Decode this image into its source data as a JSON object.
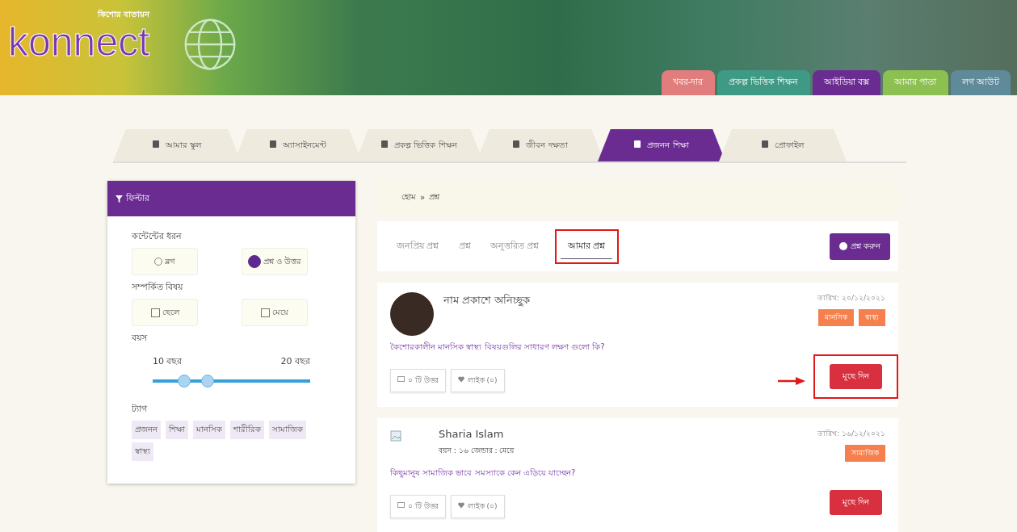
{
  "logo": {
    "tagline": "কিশোর বাতায়ন",
    "name": "konnect"
  },
  "top_nav": [
    {
      "label": "খবর-দার",
      "color": "#e27d7d"
    },
    {
      "label": "প্রকল্প ভিত্তিক শিক্ষন",
      "color": "#3f9a85"
    },
    {
      "label": "আইডিয়া বক্স",
      "color": "#6a2c91"
    },
    {
      "label": "আমার পাতা",
      "color": "#8cc152"
    },
    {
      "label": "লগ আউট",
      "color": "#5f8a99"
    }
  ],
  "tabs": [
    {
      "label": "আমার স্কুল",
      "selected": false
    },
    {
      "label": "অ্যাসাইনমেন্ট",
      "selected": false
    },
    {
      "label": "প্রকল্প ভিত্তিক শিক্ষন",
      "selected": false
    },
    {
      "label": "জীবন দক্ষতা",
      "selected": false
    },
    {
      "label": "প্রজনন শিক্ষা",
      "selected": true
    },
    {
      "label": "প্রোফাইল",
      "selected": false
    }
  ],
  "filter": {
    "title": "ফিল্টার",
    "content_type": {
      "label": "কন্টেন্টের ধরন",
      "options": [
        {
          "label": "ব্লগ",
          "selected": false
        },
        {
          "label": "প্রশ্ন ও উত্তর",
          "selected": true
        }
      ]
    },
    "related": {
      "label": "সম্পর্কিত বিষয়",
      "options": [
        {
          "label": "ছেলে",
          "checked": false
        },
        {
          "label": "মেয়ে",
          "checked": false
        }
      ]
    },
    "age": {
      "label": "বয়স",
      "low_label": "10 বছর",
      "high_label": "20 বছর",
      "thumbs": [
        {
          "level": 0.2
        },
        {
          "level": 0.35
        }
      ]
    },
    "tags": {
      "label": "ট্যাগ",
      "items": [
        "প্রজনন",
        "শিক্ষা",
        "মানসিক",
        "শারীরিক",
        "সামাজিক",
        "স্বাস্থ্য"
      ]
    }
  },
  "breadcrumb": [
    "হোম",
    "»",
    "প্রশ্ন"
  ],
  "question_tabs": [
    {
      "label": "জনপ্রিয় প্রশ্ন",
      "selected": false,
      "outlined": false
    },
    {
      "label": "প্রশ্ন",
      "selected": false,
      "outlined": false
    },
    {
      "label": "অনুত্তরিত প্রশ্ন",
      "selected": false,
      "outlined": false
    },
    {
      "label": "আমার প্রশ্ন",
      "selected": true,
      "outlined": true
    }
  ],
  "ask_button": "প্রশ্ন করুন",
  "questions": [
    {
      "kind": "photo",
      "name": "নাম প্রকাশে অনিচ্ছুক",
      "date": "তারিখ: ২০/১২/২০২১",
      "tags": [
        {
          "label": "মানসিক"
        },
        {
          "label": "স্বাস্থ্য"
        }
      ],
      "text": "কৈশোরকালীন মানসিক স্বাস্থ্য বিষয়গুলির সাধারণ লক্ষণ গুলো কি?",
      "answers": "০ টি উত্তর",
      "likes": "লাইক (০)",
      "delete": "মুছে দিন",
      "annotated": true
    },
    {
      "kind": "broken",
      "name": "Sharia Islam",
      "details": "বয়স : ১৬ জেন্ডার : মেয়ে",
      "date": "তারিখ: ১৬/১২/২০২১",
      "tags": [
        {
          "label": "সামাজিক"
        }
      ],
      "text": "কিছুমানুষ সামাজিক ভাবে সমস্যাকে কেন এড়িয়ে যাচ্ছেন?",
      "answers": "০ টি উত্তর",
      "likes": "লাইক (০)",
      "delete": "মুছে দিন",
      "annotated": false
    }
  ]
}
